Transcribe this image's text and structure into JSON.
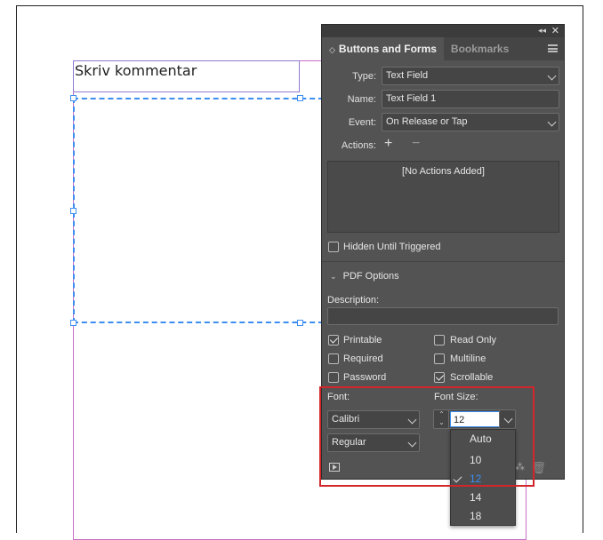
{
  "document": {
    "frame_text": "Skriv kommentar"
  },
  "panel": {
    "tabs": [
      {
        "label": "Buttons and Forms",
        "active": true
      },
      {
        "label": "Bookmarks",
        "active": false
      }
    ],
    "type_label": "Type:",
    "type_value": "Text Field",
    "name_label": "Name:",
    "name_value": "Text Field 1",
    "event_label": "Event:",
    "event_value": "On Release or Tap",
    "actions_label": "Actions:",
    "add_action": "+",
    "remove_action": "−",
    "actions_empty": "[No Actions Added]",
    "hidden_until_triggered": "Hidden Until Triggered",
    "pdf_options": "PDF Options",
    "description_label": "Description:",
    "description_value": "",
    "checkboxes": {
      "printable": {
        "label": "Printable",
        "checked": true
      },
      "read_only": {
        "label": "Read Only",
        "checked": false
      },
      "required": {
        "label": "Required",
        "checked": false
      },
      "multiline": {
        "label": "Multiline",
        "checked": false
      },
      "password": {
        "label": "Password",
        "checked": false
      },
      "scrollable": {
        "label": "Scrollable",
        "checked": true
      }
    },
    "font_label": "Font:",
    "font_family": "Calibri",
    "font_style": "Regular",
    "font_size_label": "Font Size:",
    "font_size_value": "12",
    "font_size_options": [
      "Auto",
      "10",
      "12",
      "14",
      "18"
    ],
    "font_size_selected": "12"
  },
  "colors": {
    "panel_bg": "#535353",
    "selection_blue": "#3d8ef0",
    "highlight_red": "#d2262b"
  }
}
